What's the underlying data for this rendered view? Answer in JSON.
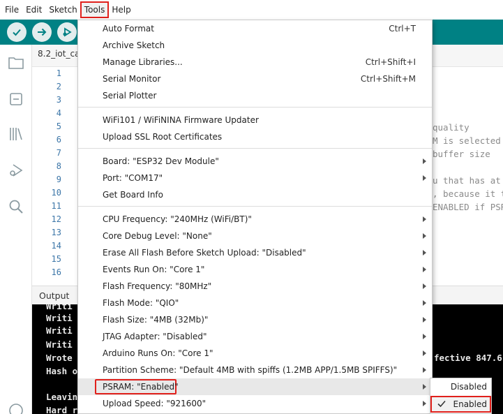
{
  "menubar": {
    "items": [
      "File",
      "Edit",
      "Sketch",
      "Tools",
      "Help"
    ]
  },
  "toolbar": {
    "buttons": [
      "verify-icon",
      "upload-icon",
      "debug-icon"
    ],
    "accent": "#008184"
  },
  "sidebar": {
    "icons": [
      "folder-icon",
      "board-icon",
      "library-icon",
      "debug-icon",
      "search-icon"
    ]
  },
  "editor": {
    "tab_label": "8.2_iot_ca",
    "line_numbers": [
      "1",
      "2",
      "3",
      "4",
      "5",
      "6",
      "7",
      "8",
      "9",
      "10",
      "11",
      "12",
      "13",
      "14",
      "15",
      "16"
    ],
    "visible_code_fragments": [
      "quality",
      "M is selected",
      "buffer size",
      "",
      "u that has at",
      ", because it t",
      "ENABLED if PSR"
    ]
  },
  "output": {
    "label": "Output",
    "lines": [
      "Writi",
      "Writi",
      "Writi",
      "Writi",
      "Wrote",
      "Hash o",
      "",
      "Leavin",
      "Hard r"
    ],
    "right_fragment": "fective 847.6"
  },
  "tools_menu": {
    "groups": [
      [
        {
          "label": "Auto Format",
          "shortcut": "Ctrl+T"
        },
        {
          "label": "Archive Sketch",
          "shortcut": ""
        },
        {
          "label": "Manage Libraries...",
          "shortcut": "Ctrl+Shift+I"
        },
        {
          "label": "Serial Monitor",
          "shortcut": "Ctrl+Shift+M"
        },
        {
          "label": "Serial Plotter",
          "shortcut": ""
        }
      ],
      [
        {
          "label": "WiFi101 / WiFiNINA Firmware Updater",
          "shortcut": ""
        },
        {
          "label": "Upload SSL Root Certificates",
          "shortcut": ""
        }
      ],
      [
        {
          "label": "Board: \"ESP32 Dev Module\"",
          "submenu": true
        },
        {
          "label": "Port: \"COM17\"",
          "submenu": true
        },
        {
          "label": "Get Board Info",
          "shortcut": ""
        }
      ],
      [
        {
          "label": "CPU Frequency: \"240MHz (WiFi/BT)\"",
          "submenu": true
        },
        {
          "label": "Core Debug Level: \"None\"",
          "submenu": true
        },
        {
          "label": "Erase All Flash Before Sketch Upload: \"Disabled\"",
          "submenu": true
        },
        {
          "label": "Events Run On: \"Core 1\"",
          "submenu": true
        },
        {
          "label": "Flash Frequency: \"80MHz\"",
          "submenu": true
        },
        {
          "label": "Flash Mode: \"QIO\"",
          "submenu": true
        },
        {
          "label": "Flash Size: \"4MB (32Mb)\"",
          "submenu": true
        },
        {
          "label": "JTAG Adapter: \"Disabled\"",
          "submenu": true
        },
        {
          "label": "Arduino Runs On: \"Core 1\"",
          "submenu": true
        },
        {
          "label": "Partition Scheme: \"Default 4MB with spiffs (1.2MB APP/1.5MB SPIFFS)\"",
          "submenu": true
        },
        {
          "label": "PSRAM: \"Enabled\"",
          "submenu": true,
          "highlighted": true
        },
        {
          "label": "Upload Speed: \"921600\"",
          "submenu": true
        }
      ]
    ]
  },
  "psram_submenu": {
    "items": [
      {
        "label": "Disabled",
        "checked": false
      },
      {
        "label": "Enabled",
        "checked": true
      }
    ],
    "highlight_color": "#e0201b"
  }
}
